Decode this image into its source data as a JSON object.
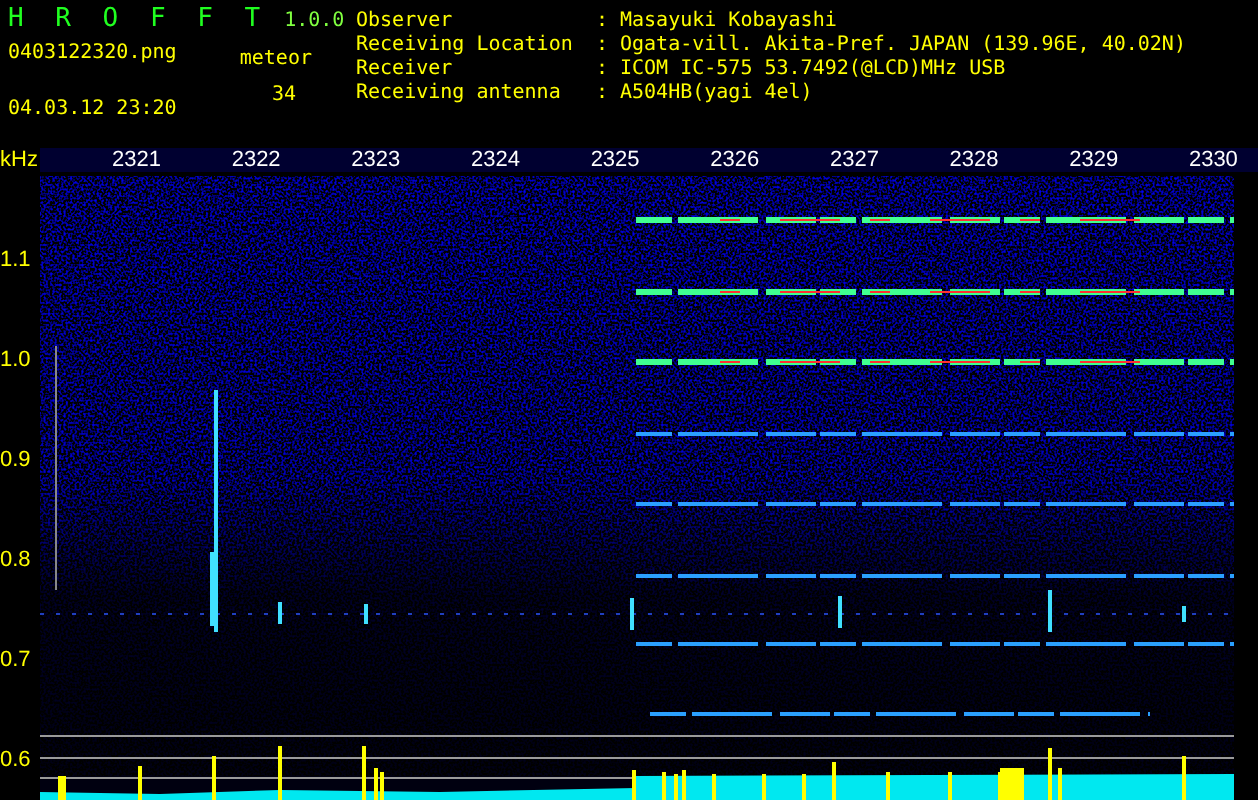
{
  "app": {
    "name": "H R O F F T",
    "version": "1.0.0"
  },
  "file": {
    "name": "0403122320.png",
    "datetime": "04.03.12 23:20"
  },
  "meteor": {
    "label": "meteor",
    "count": "34"
  },
  "info": [
    {
      "label": "Observer",
      "separator": ":",
      "value": "Masayuki Kobayashi"
    },
    {
      "label": "Receiving Location",
      "separator": ":",
      "value": "Ogata-vill. Akita-Pref. JAPAN (139.96E, 40.02N)"
    },
    {
      "label": "Receiver",
      "separator": ":",
      "value": "ICOM IC-575 53.7492(@LCD)MHz USB"
    },
    {
      "label": "Receiving antenna",
      "separator": ":",
      "value": "A504HB(yagi 4el)"
    }
  ],
  "time_axis": {
    "labels": [
      "2321",
      "2322",
      "2323",
      "2324",
      "2325",
      "2326",
      "2327",
      "2328",
      "2329",
      "2330"
    ]
  },
  "frequency_axis": {
    "unit": "kHz",
    "labels": [
      "1.1",
      "1.0",
      "0.9",
      "0.8",
      "0.7",
      "0.6"
    ]
  }
}
